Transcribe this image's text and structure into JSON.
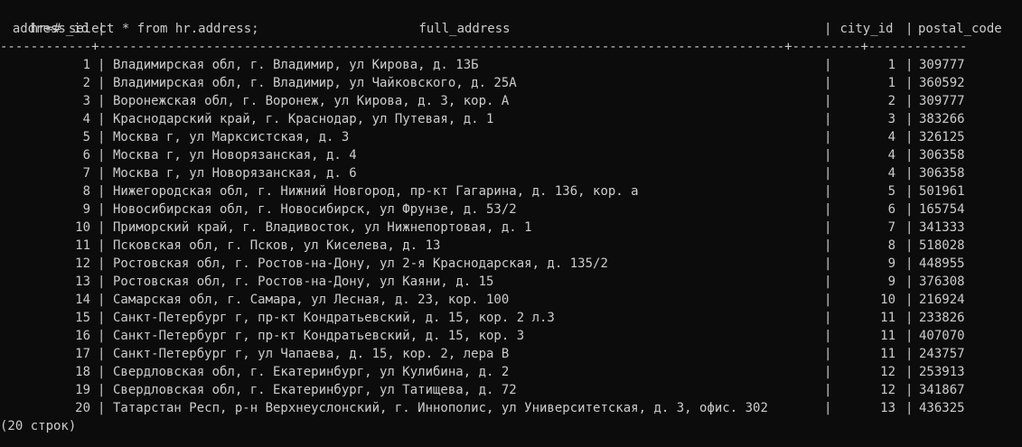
{
  "terminal": {
    "prompt": "hr=# ",
    "command": "select * from hr.address;",
    "headers": {
      "address_id": "address_id",
      "full_address": "full_address",
      "city_id": "city_id",
      "postal_code": "postal_code"
    },
    "separator": "------------+------------------------------------------------------------------------------------------+---------+-------------",
    "rows": [
      {
        "address_id": "1",
        "full_address": "Владимирская обл, г. Владимир, ул Кирова, д. 13Б",
        "city_id": "1",
        "postal_code": "309777"
      },
      {
        "address_id": "2",
        "full_address": "Владимирская обл, г. Владимир, ул Чайковского, д. 25А",
        "city_id": "1",
        "postal_code": "360592"
      },
      {
        "address_id": "3",
        "full_address": "Воронежская обл, г. Воронеж, ул Кирова, д. 3, кор. А",
        "city_id": "2",
        "postal_code": "309777"
      },
      {
        "address_id": "4",
        "full_address": "Краснодарский край, г. Краснодар, ул Путевая, д. 1",
        "city_id": "3",
        "postal_code": "383266"
      },
      {
        "address_id": "5",
        "full_address": "Москва г, ул Марксистская, д. 3",
        "city_id": "4",
        "postal_code": "326125"
      },
      {
        "address_id": "6",
        "full_address": "Москва г, ул Новорязанская, д. 4",
        "city_id": "4",
        "postal_code": "306358"
      },
      {
        "address_id": "7",
        "full_address": "Москва г, ул Новорязанская, д. 6",
        "city_id": "4",
        "postal_code": "306358"
      },
      {
        "address_id": "8",
        "full_address": "Нижегородская обл, г. Нижний Новгород, пр-кт Гагарина, д. 136, кор. а",
        "city_id": "5",
        "postal_code": "501961"
      },
      {
        "address_id": "9",
        "full_address": "Новосибирская обл, г. Новосибирск, ул Фрунзе, д. 53/2",
        "city_id": "6",
        "postal_code": "165754"
      },
      {
        "address_id": "10",
        "full_address": "Приморский край, г. Владивосток, ул Нижнепортовая, д. 1",
        "city_id": "7",
        "postal_code": "341333"
      },
      {
        "address_id": "11",
        "full_address": "Псковская обл, г. Псков, ул Киселева, д. 13",
        "city_id": "8",
        "postal_code": "518028"
      },
      {
        "address_id": "12",
        "full_address": "Ростовская обл, г. Ростов-на-Дону, ул 2-я Краснодарская, д. 135/2",
        "city_id": "9",
        "postal_code": "448955"
      },
      {
        "address_id": "13",
        "full_address": "Ростовская обл, г. Ростов-на-Дону, ул Каяни, д. 15",
        "city_id": "9",
        "postal_code": "376308"
      },
      {
        "address_id": "14",
        "full_address": "Самарская обл, г. Самара, ул Лесная, д. 23, кор. 100",
        "city_id": "10",
        "postal_code": "216924"
      },
      {
        "address_id": "15",
        "full_address": "Санкт-Петербург г, пр-кт Кондратьевский, д. 15, кор. 2 л.3",
        "city_id": "11",
        "postal_code": "233826"
      },
      {
        "address_id": "16",
        "full_address": "Санкт-Петербург г, пр-кт Кондратьевский, д. 15, кор. 3",
        "city_id": "11",
        "postal_code": "407070"
      },
      {
        "address_id": "17",
        "full_address": "Санкт-Петербург г, ул Чапаева, д. 15, кор. 2, лера В",
        "city_id": "11",
        "postal_code": "243757"
      },
      {
        "address_id": "18",
        "full_address": "Свердловская обл, г. Екатеринбург, ул Кулибина, д. 2",
        "city_id": "12",
        "postal_code": "253913"
      },
      {
        "address_id": "19",
        "full_address": "Свердловская обл, г. Екатеринбург, ул Татищева, д. 72",
        "city_id": "12",
        "postal_code": "341867"
      },
      {
        "address_id": "20",
        "full_address": "Татарстан Респ, р-н Верхнеуслонский, г. Иннополис, ул Университетская, д. 3, офис. 302",
        "city_id": "13",
        "postal_code": "436325"
      }
    ],
    "footer": "(20 строк)",
    "colors": {
      "background": "#0c0c0c",
      "foreground": "#cccccc"
    }
  }
}
